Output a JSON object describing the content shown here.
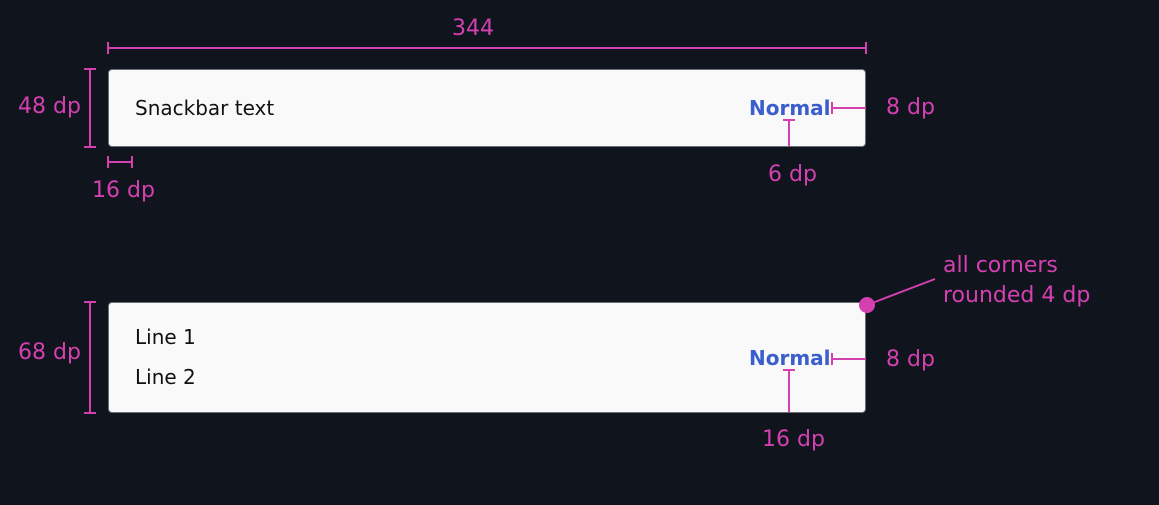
{
  "spec_colors": {
    "annotation": "#d440b0",
    "background": "#10141d",
    "snackbar_surface": "#f9f9f9",
    "action": "#3a5fcd"
  },
  "single_line": {
    "text": "Snackbar text",
    "action_label": "Normal",
    "width_label": "344",
    "height_label": "48 dp",
    "left_padding_label": "16 dp",
    "right_padding_label": "8 dp",
    "bottom_padding_label": "6 dp"
  },
  "two_line": {
    "line1": "Line 1",
    "line2": "Line 2",
    "action_label": "Normal",
    "height_label": "68 dp",
    "right_padding_label": "8 dp",
    "bottom_padding_label": "16 dp",
    "corner_note_line1": "all corners",
    "corner_note_line2": "rounded 4 dp"
  }
}
